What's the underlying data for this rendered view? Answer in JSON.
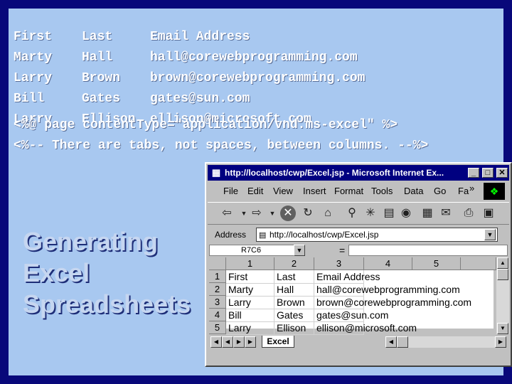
{
  "code_lines": [
    {
      "c1": "First",
      "c2": "Last",
      "c3": "Email Address"
    },
    {
      "c1": "Marty",
      "c2": "Hall",
      "c3": "hall@corewebprogramming.com"
    },
    {
      "c1": "Larry",
      "c2": "Brown",
      "c3": "brown@corewebprogramming.com"
    },
    {
      "c1": "Bill",
      "c2": "Gates",
      "c3": "gates@sun.com"
    },
    {
      "c1": "Larry",
      "c2": "Ellison",
      "c3": "ellison@microsoft.com"
    }
  ],
  "directive_1": "<%@ page contentType=\"application/vnd.ms-excel\" %>",
  "directive_2": "<%-- There are tabs, not spaces, between columns. --%>",
  "heading": {
    "line1": "Generating",
    "line2": "Excel",
    "line3": "Spreadsheets"
  },
  "browser": {
    "title": "http://localhost/cwp/Excel.jsp - Microsoft Internet Ex...",
    "menu": [
      "File",
      "Edit",
      "View",
      "Insert",
      "Format",
      "Tools",
      "Data",
      "Go",
      "Fa"
    ],
    "address_label": "Address",
    "address_value": "http://localhost/cwp/Excel.jsp",
    "name_box": "R7C6",
    "equals": "=",
    "col_headers": [
      "1",
      "2",
      "3",
      "4",
      "5"
    ],
    "row_headers": [
      "1",
      "2",
      "3",
      "4",
      "5"
    ],
    "rows": [
      [
        "First",
        "Last",
        "Email Address"
      ],
      [
        "Marty",
        "Hall",
        "hall@corewebprogramming.com"
      ],
      [
        "Larry",
        "Brown",
        "brown@corewebprogramming.com"
      ],
      [
        "Bill",
        "Gates",
        "gates@sun.com"
      ],
      [
        "Larry",
        "Ellison",
        "ellison@microsoft.com"
      ]
    ],
    "sheet_tab": "Excel",
    "chevron": "»"
  },
  "colors": {
    "frame": "#08087a",
    "slide": "#a8c8f0",
    "titlebar": "#000080"
  }
}
